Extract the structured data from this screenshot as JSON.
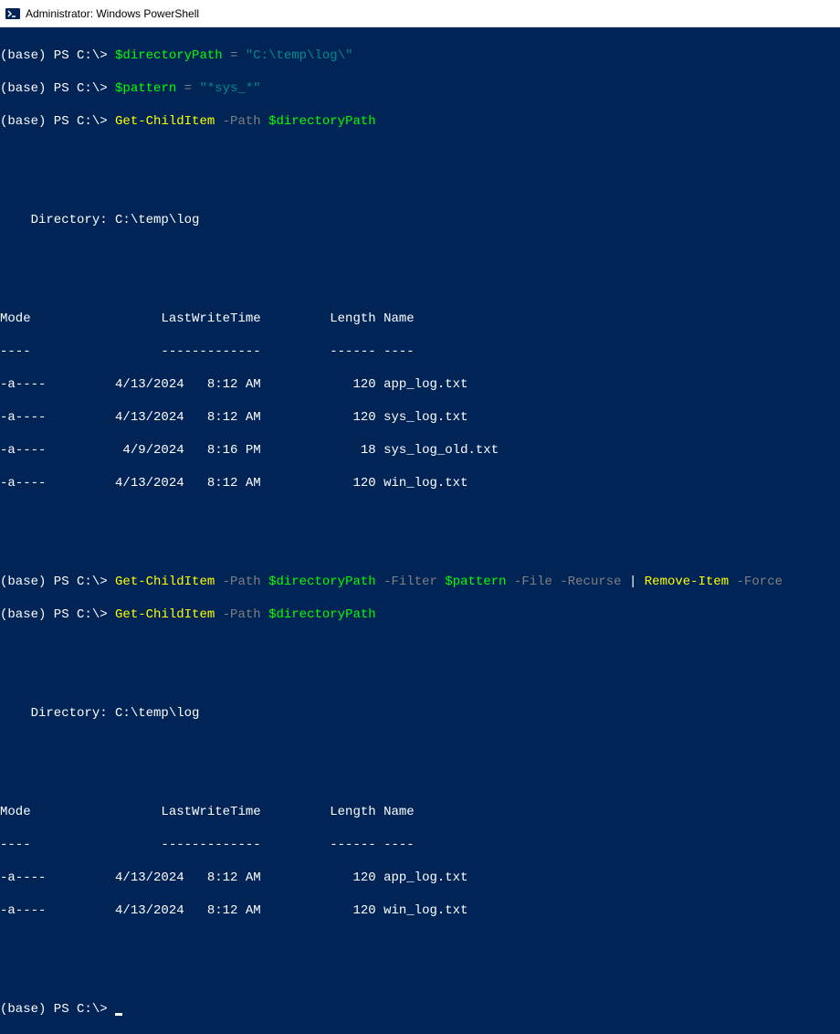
{
  "window": {
    "title": "Administrator: Windows PowerShell"
  },
  "prompt": {
    "prefix": "(base) PS C:\\>"
  },
  "commands": {
    "l1_var": "$directoryPath",
    "l1_eq": " = ",
    "l1_str": "\"C:\\temp\\log\\\"",
    "l2_var": "$pattern",
    "l2_eq": " = ",
    "l2_str": "\"*sys_*\"",
    "l3_cmd": "Get-ChildItem",
    "l3_flag": " -Path ",
    "l3_var": "$directoryPath",
    "l7_cmd": "Get-ChildItem",
    "l7_f1": " -Path ",
    "l7_v1": "$directoryPath",
    "l7_f2": " -Filter ",
    "l7_v2": "$pattern",
    "l7_f3": " -File -Recurse ",
    "l7_pipe": "|",
    "l7_cmd2": " Remove-Item",
    "l7_f4": " -Force",
    "l8_cmd": "Get-ChildItem",
    "l8_flag": " -Path ",
    "l8_var": "$directoryPath"
  },
  "listing1": {
    "dirline": "    Directory: C:\\temp\\log",
    "header": "Mode                 LastWriteTime         Length Name",
    "divider": "----                 -------------         ------ ----",
    "rows": [
      "-a----         4/13/2024   8:12 AM            120 app_log.txt",
      "-a----         4/13/2024   8:12 AM            120 sys_log.txt",
      "-a----          4/9/2024   8:16 PM             18 sys_log_old.txt",
      "-a----         4/13/2024   8:12 AM            120 win_log.txt"
    ]
  },
  "listing2": {
    "dirline": "    Directory: C:\\temp\\log",
    "header": "Mode                 LastWriteTime         Length Name",
    "divider": "----                 -------------         ------ ----",
    "rows": [
      "-a----         4/13/2024   8:12 AM            120 app_log.txt",
      "-a----         4/13/2024   8:12 AM            120 win_log.txt"
    ]
  }
}
